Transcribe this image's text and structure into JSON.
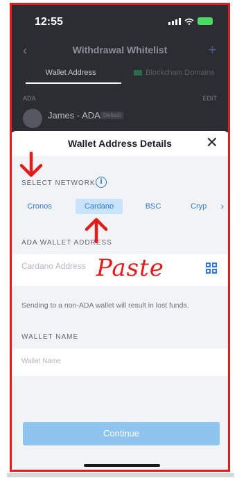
{
  "status_bar": {
    "time": "12:55"
  },
  "header": {
    "back_icon": "chevron-left-icon",
    "title": "Withdrawal Whitelist",
    "add_icon": "plus-icon"
  },
  "tabs": [
    {
      "label": "Wallet Address"
    },
    {
      "label": "Blockchain Domains"
    }
  ],
  "list": {
    "section": "ADA",
    "edit": "EDIT",
    "contact_name": "James - ADA",
    "contact_badge": "Default"
  },
  "modal": {
    "title": "Wallet Address Details",
    "close_icon": "close-icon",
    "network_label": "SELECT NETWORK",
    "info_icon": "i",
    "networks": [
      "Cronos",
      "Cardano",
      "BSC",
      "Cryp"
    ],
    "selected_network": "Cardano",
    "address_label": "ADA WALLET ADDRESS",
    "address_placeholder": "Cardano Address",
    "warning": "Sending to a non-ADA wallet will result in lost funds.",
    "wallet_name_label": "WALLET NAME",
    "wallet_name_placeholder": "Wallet Name",
    "continue_label": "Continue"
  },
  "annotations": {
    "paste_text": "Paste",
    "color": "#e21b1b"
  },
  "colors": {
    "accent": "#2f7ad6",
    "button": "#8ec4ee",
    "annotation": "#e21b1b"
  }
}
